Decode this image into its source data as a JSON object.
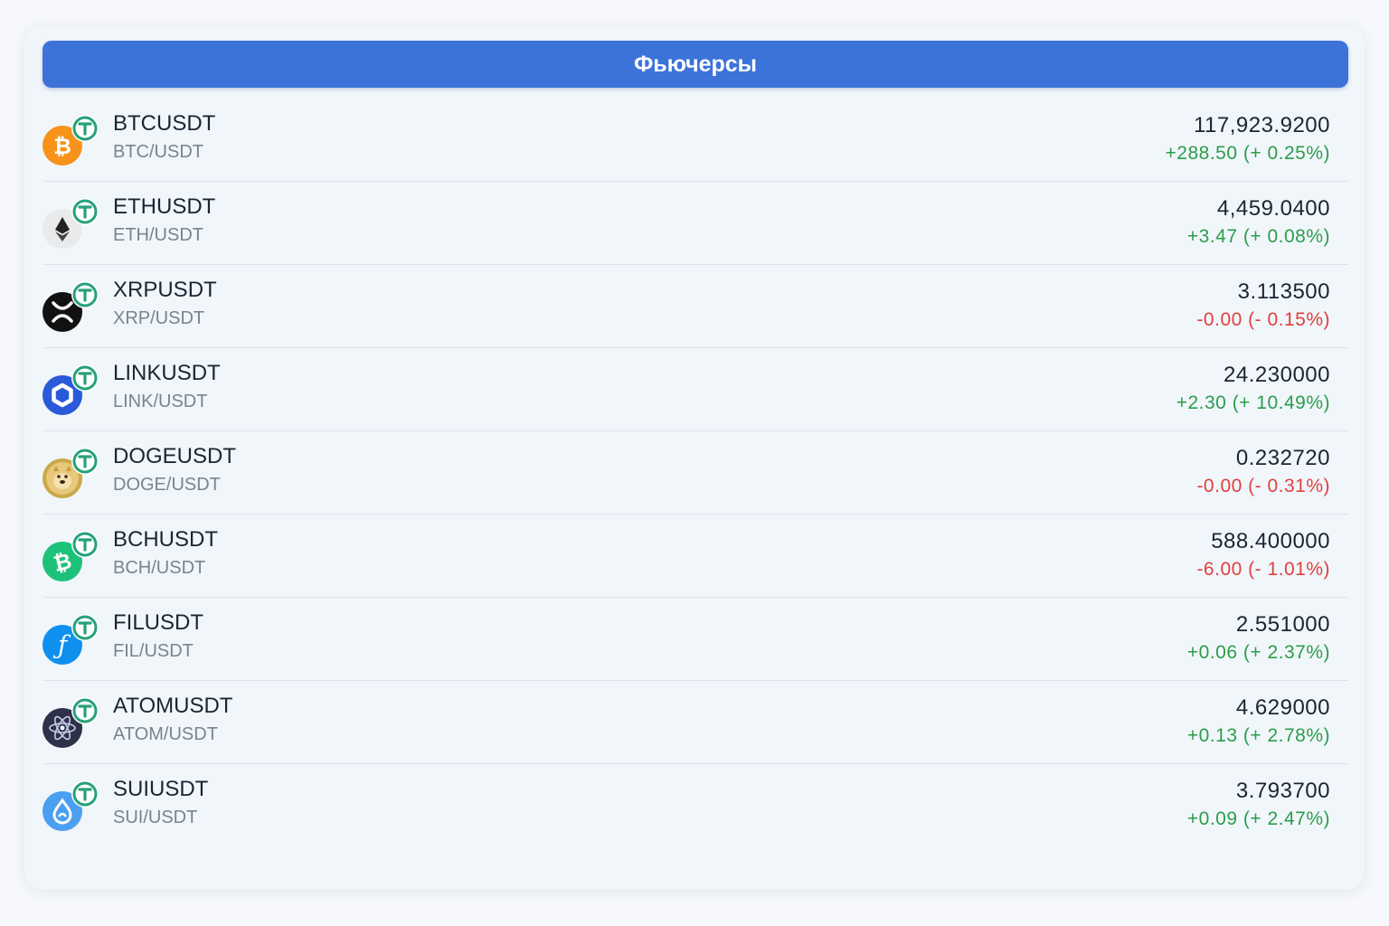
{
  "header": {
    "title": "Фьючерсы"
  },
  "rows": [
    {
      "symbol": "BTCUSDT",
      "pair": "BTC/USDT",
      "price": "117,923.9200",
      "change": "+288.50 (+ 0.25%)",
      "trend": "up",
      "icon": "bitcoin-icon",
      "color": "#f7931a"
    },
    {
      "symbol": "ETHUSDT",
      "pair": "ETH/USDT",
      "price": "4,459.0400",
      "change": "+3.47 (+ 0.08%)",
      "trend": "up",
      "icon": "ethereum-icon",
      "color": "#e9eaec"
    },
    {
      "symbol": "XRPUSDT",
      "pair": "XRP/USDT",
      "price": "3.113500",
      "change": "-0.00 (- 0.15%)",
      "trend": "down",
      "icon": "xrp-icon",
      "color": "#111111"
    },
    {
      "symbol": "LINKUSDT",
      "pair": "LINK/USDT",
      "price": "24.230000",
      "change": "+2.30 (+ 10.49%)",
      "trend": "up",
      "icon": "chainlink-icon",
      "color": "#2a5ada"
    },
    {
      "symbol": "DOGEUSDT",
      "pair": "DOGE/USDT",
      "price": "0.232720",
      "change": "-0.00 (- 0.31%)",
      "trend": "down",
      "icon": "dogecoin-icon",
      "color": "#c9a948"
    },
    {
      "symbol": "BCHUSDT",
      "pair": "BCH/USDT",
      "price": "588.400000",
      "change": "-6.00 (- 1.01%)",
      "trend": "down",
      "icon": "bitcoin-cash-icon",
      "color": "#1dc27a"
    },
    {
      "symbol": "FILUSDT",
      "pair": "FIL/USDT",
      "price": "2.551000",
      "change": "+0.06 (+ 2.37%)",
      "trend": "up",
      "icon": "filecoin-icon",
      "color": "#0f90ee"
    },
    {
      "symbol": "ATOMUSDT",
      "pair": "ATOM/USDT",
      "price": "4.629000",
      "change": "+0.13 (+ 2.78%)",
      "trend": "up",
      "icon": "cosmos-atom-icon",
      "color": "#2e3148"
    },
    {
      "symbol": "SUIUSDT",
      "pair": "SUI/USDT",
      "price": "3.793700",
      "change": "+0.09 (+ 2.47%)",
      "trend": "up",
      "icon": "sui-icon",
      "color": "#4b9ff0"
    }
  ],
  "tether_icon": "tether-icon",
  "colors": {
    "accent": "#3c73d8",
    "up": "#2a9d4a",
    "down": "#e0403c",
    "tether": "#26a17b"
  }
}
